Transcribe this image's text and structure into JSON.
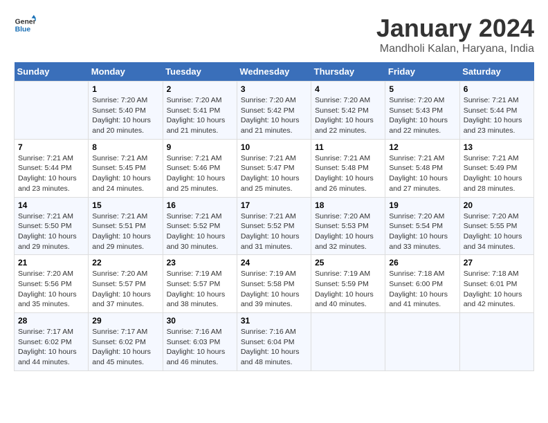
{
  "header": {
    "logo_line1": "General",
    "logo_line2": "Blue",
    "title": "January 2024",
    "subtitle": "Mandholi Kalan, Haryana, India"
  },
  "columns": [
    "Sunday",
    "Monday",
    "Tuesday",
    "Wednesday",
    "Thursday",
    "Friday",
    "Saturday"
  ],
  "weeks": [
    {
      "days": [
        {
          "number": "",
          "info": ""
        },
        {
          "number": "1",
          "info": "Sunrise: 7:20 AM\nSunset: 5:40 PM\nDaylight: 10 hours\nand 20 minutes."
        },
        {
          "number": "2",
          "info": "Sunrise: 7:20 AM\nSunset: 5:41 PM\nDaylight: 10 hours\nand 21 minutes."
        },
        {
          "number": "3",
          "info": "Sunrise: 7:20 AM\nSunset: 5:42 PM\nDaylight: 10 hours\nand 21 minutes."
        },
        {
          "number": "4",
          "info": "Sunrise: 7:20 AM\nSunset: 5:42 PM\nDaylight: 10 hours\nand 22 minutes."
        },
        {
          "number": "5",
          "info": "Sunrise: 7:20 AM\nSunset: 5:43 PM\nDaylight: 10 hours\nand 22 minutes."
        },
        {
          "number": "6",
          "info": "Sunrise: 7:21 AM\nSunset: 5:44 PM\nDaylight: 10 hours\nand 23 minutes."
        }
      ]
    },
    {
      "days": [
        {
          "number": "7",
          "info": "Sunrise: 7:21 AM\nSunset: 5:44 PM\nDaylight: 10 hours\nand 23 minutes."
        },
        {
          "number": "8",
          "info": "Sunrise: 7:21 AM\nSunset: 5:45 PM\nDaylight: 10 hours\nand 24 minutes."
        },
        {
          "number": "9",
          "info": "Sunrise: 7:21 AM\nSunset: 5:46 PM\nDaylight: 10 hours\nand 25 minutes."
        },
        {
          "number": "10",
          "info": "Sunrise: 7:21 AM\nSunset: 5:47 PM\nDaylight: 10 hours\nand 25 minutes."
        },
        {
          "number": "11",
          "info": "Sunrise: 7:21 AM\nSunset: 5:48 PM\nDaylight: 10 hours\nand 26 minutes."
        },
        {
          "number": "12",
          "info": "Sunrise: 7:21 AM\nSunset: 5:48 PM\nDaylight: 10 hours\nand 27 minutes."
        },
        {
          "number": "13",
          "info": "Sunrise: 7:21 AM\nSunset: 5:49 PM\nDaylight: 10 hours\nand 28 minutes."
        }
      ]
    },
    {
      "days": [
        {
          "number": "14",
          "info": "Sunrise: 7:21 AM\nSunset: 5:50 PM\nDaylight: 10 hours\nand 29 minutes."
        },
        {
          "number": "15",
          "info": "Sunrise: 7:21 AM\nSunset: 5:51 PM\nDaylight: 10 hours\nand 29 minutes."
        },
        {
          "number": "16",
          "info": "Sunrise: 7:21 AM\nSunset: 5:52 PM\nDaylight: 10 hours\nand 30 minutes."
        },
        {
          "number": "17",
          "info": "Sunrise: 7:21 AM\nSunset: 5:52 PM\nDaylight: 10 hours\nand 31 minutes."
        },
        {
          "number": "18",
          "info": "Sunrise: 7:20 AM\nSunset: 5:53 PM\nDaylight: 10 hours\nand 32 minutes."
        },
        {
          "number": "19",
          "info": "Sunrise: 7:20 AM\nSunset: 5:54 PM\nDaylight: 10 hours\nand 33 minutes."
        },
        {
          "number": "20",
          "info": "Sunrise: 7:20 AM\nSunset: 5:55 PM\nDaylight: 10 hours\nand 34 minutes."
        }
      ]
    },
    {
      "days": [
        {
          "number": "21",
          "info": "Sunrise: 7:20 AM\nSunset: 5:56 PM\nDaylight: 10 hours\nand 35 minutes."
        },
        {
          "number": "22",
          "info": "Sunrise: 7:20 AM\nSunset: 5:57 PM\nDaylight: 10 hours\nand 37 minutes."
        },
        {
          "number": "23",
          "info": "Sunrise: 7:19 AM\nSunset: 5:57 PM\nDaylight: 10 hours\nand 38 minutes."
        },
        {
          "number": "24",
          "info": "Sunrise: 7:19 AM\nSunset: 5:58 PM\nDaylight: 10 hours\nand 39 minutes."
        },
        {
          "number": "25",
          "info": "Sunrise: 7:19 AM\nSunset: 5:59 PM\nDaylight: 10 hours\nand 40 minutes."
        },
        {
          "number": "26",
          "info": "Sunrise: 7:18 AM\nSunset: 6:00 PM\nDaylight: 10 hours\nand 41 minutes."
        },
        {
          "number": "27",
          "info": "Sunrise: 7:18 AM\nSunset: 6:01 PM\nDaylight: 10 hours\nand 42 minutes."
        }
      ]
    },
    {
      "days": [
        {
          "number": "28",
          "info": "Sunrise: 7:17 AM\nSunset: 6:02 PM\nDaylight: 10 hours\nand 44 minutes."
        },
        {
          "number": "29",
          "info": "Sunrise: 7:17 AM\nSunset: 6:02 PM\nDaylight: 10 hours\nand 45 minutes."
        },
        {
          "number": "30",
          "info": "Sunrise: 7:16 AM\nSunset: 6:03 PM\nDaylight: 10 hours\nand 46 minutes."
        },
        {
          "number": "31",
          "info": "Sunrise: 7:16 AM\nSunset: 6:04 PM\nDaylight: 10 hours\nand 48 minutes."
        },
        {
          "number": "",
          "info": ""
        },
        {
          "number": "",
          "info": ""
        },
        {
          "number": "",
          "info": ""
        }
      ]
    }
  ]
}
